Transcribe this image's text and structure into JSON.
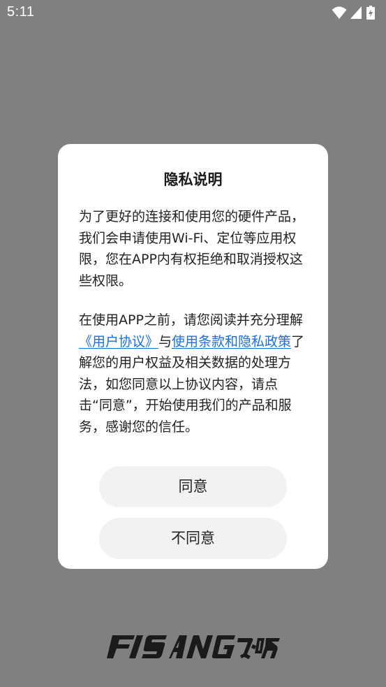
{
  "status_bar": {
    "time": "5:11",
    "icons": [
      "wifi-icon",
      "cellular-signal-icon",
      "battery-charging-icon"
    ]
  },
  "dialog": {
    "title": "隐私说明",
    "paragraph1": "为了更好的连接和使用您的硬件产品，我们会申请使用Wi-Fi、定位等应用权限，您在APP内有权拒绝和取消授权这些权限。",
    "paragraph2": {
      "before_link": "在使用APP之前，请您阅读并充分理解",
      "user_agreement_link": "《用户协议》",
      "between": "与",
      "terms_privacy_link": "使用条款和隐私政策",
      "after_link": "了解您的用户权益及相关数据的处理方法，如您同意以上协议内容，请点击“同意”，开始使用我们的产品和服务，感谢您的信任。"
    },
    "agree_button": "同意",
    "disagree_button": "不同意"
  },
  "brand": {
    "logo_text": "FISANG飞畅"
  },
  "colors": {
    "backdrop": "#808080",
    "dialog_bg": "#ffffff",
    "link": "#1a6fe0",
    "button_bg": "#f2f2f2",
    "logo": "#1a1a1a"
  }
}
